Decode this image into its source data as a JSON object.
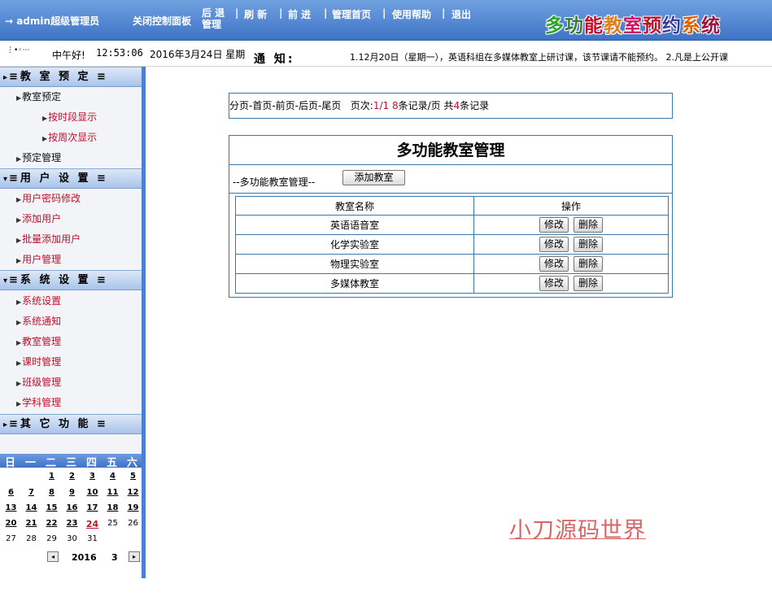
{
  "header": {
    "user": "→ admin超级管理员",
    "nav": {
      "close_panel": "关闭控制面板",
      "back_line1": "后 退",
      "back_line2": "管理",
      "refresh": "刷 新",
      "forward": "前 进",
      "home": "管理首页",
      "help": "使用帮助",
      "logout": "退出",
      "sep": "|"
    },
    "app_title": "多功能教室预约系统",
    "title_colors": [
      "#2aa52a",
      "#3a7a3a",
      "#c0102a",
      "#e08020",
      "#d01060",
      "#c0102a",
      "#3a3a9a",
      "#e06000",
      "#a01040"
    ]
  },
  "infobar": {
    "greeting": "中午好!",
    "time": "12:53:06",
    "date": "2016年3月24日 星期",
    "notice_label": "通 知:",
    "notice_text": "1.12月20日（星期一），英语科组在多媒体教室上研讨课，该节课请不能预约。 2.凡是上公开课"
  },
  "sidebar": {
    "sections": [
      {
        "title": "≡教 室 预 定 ≡",
        "arrow": "▸"
      },
      {
        "title": "≡用 户 设 置 ≡",
        "arrow": "▾"
      },
      {
        "title": "≡系 统 设 置 ≡",
        "arrow": "▾"
      },
      {
        "title": "≡其 它 功 能 ≡",
        "arrow": "▸"
      }
    ],
    "items": {
      "room_booking": "教室预定",
      "by_period": "按时段显示",
      "by_week": "按周次显示",
      "booking_manage": "预定管理",
      "password_change": "用户密码修改",
      "add_user": "添加用户",
      "batch_add_user": "批量添加用户",
      "user_manage": "用户管理",
      "system_settings": "系统设置",
      "system_notice": "系统通知",
      "classroom_manage": "教室管理",
      "lesson_manage": "课时管理",
      "class_manage": "班级管理",
      "subject_manage": "学科管理"
    }
  },
  "calendar": {
    "weekdays": [
      "日",
      "一",
      "二",
      "三",
      "四",
      "五",
      "六"
    ],
    "weeks": [
      [
        "",
        "",
        "",
        "1",
        "2",
        "3",
        "4",
        "5"
      ],
      [
        "6",
        "7",
        "8",
        "9",
        "10",
        "11",
        "12"
      ],
      [
        "13",
        "14",
        "15",
        "16",
        "17",
        "18",
        "19"
      ],
      [
        "20",
        "21",
        "22",
        "23",
        "24",
        "25",
        "26"
      ],
      [
        "27",
        "28",
        "29",
        "30",
        "31",
        "",
        ""
      ]
    ],
    "today": "24",
    "year": "2016",
    "month": "3",
    "prev": "◂",
    "next": "▸"
  },
  "main": {
    "pager": {
      "links": "分页-首页-前页-后页-尾页",
      "page_label": "页次:",
      "page_value": "1/1",
      "per_page_value": "8",
      "per_page_label": "条记录/页",
      "total_label": "共",
      "total_value": "4",
      "total_suffix": "条记录"
    },
    "panel_title": "多功能教室管理",
    "panel_sub": "--多功能教室管理--",
    "add_button": "添加教室",
    "table": {
      "headers": [
        "教室名称",
        "操作"
      ],
      "rows": [
        "英语语音室",
        "化学实验室",
        "物理实验室",
        "多媒体教室"
      ],
      "edit": "修改",
      "delete": "删除"
    },
    "watermark": "小刀源码世界"
  }
}
